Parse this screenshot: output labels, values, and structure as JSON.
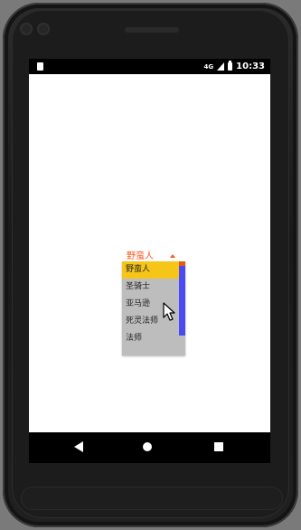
{
  "status_bar": {
    "signal_label": "4G",
    "time": "10:33"
  },
  "spinner": {
    "selected_value": "野蛮人",
    "accent_color": "#ff5722"
  },
  "dropdown": {
    "items": [
      {
        "label": "野蛮人",
        "selected": true
      },
      {
        "label": "圣骑士",
        "selected": false
      },
      {
        "label": "亚马逊",
        "selected": false
      },
      {
        "label": "死灵法师",
        "selected": false
      },
      {
        "label": "法师",
        "selected": false
      }
    ],
    "selected_color": "#f5c518",
    "background_color": "#bdbdbd",
    "scroll_color": "#4a4af0"
  },
  "icons": {
    "status_left": "sd-card-icon",
    "signal": "cell-signal-icon",
    "battery": "battery-icon",
    "back": "back-icon",
    "home": "home-icon",
    "recents": "recents-icon",
    "cursor": "mouse-pointer-icon"
  }
}
